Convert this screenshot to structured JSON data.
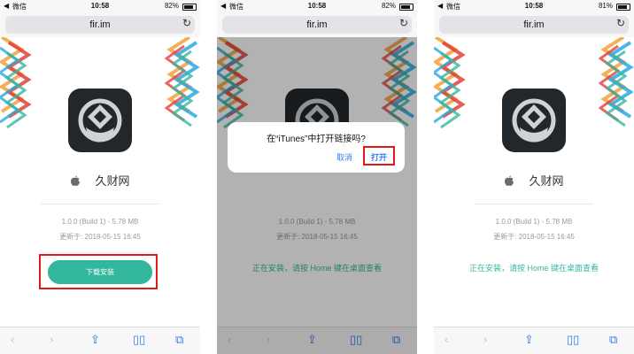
{
  "status_bar": {
    "back_label": "◀",
    "carrier": "微信",
    "time": "10:58"
  },
  "screens": [
    {
      "battery": "82%",
      "battery_level": 0.82
    },
    {
      "battery": "82%",
      "battery_level": 0.82
    },
    {
      "battery": "81%",
      "battery_level": 0.81
    }
  ],
  "url": "fir.im",
  "app": {
    "name": "久财网",
    "version": "1.0.0 (Build 1) - 5.78 MB",
    "updated": "更新于: 2018-05-15 16:45"
  },
  "download_button": "下载安装",
  "install_message": "正在安装，请按 Home 键在桌面查看",
  "dialog": {
    "title": "在“iTunes”中打开链接吗?",
    "cancel": "取消",
    "open": "打开"
  },
  "colors": {
    "accent": "#32b79d",
    "highlight": "#e01b1b",
    "ios_blue": "#2f7df6",
    "icon_bg": "#22272b"
  },
  "icons": [
    "reload-icon",
    "back-arrow-icon",
    "forward-arrow-icon",
    "share-icon",
    "bookmarks-icon",
    "tabs-icon",
    "apple-logo-icon"
  ]
}
